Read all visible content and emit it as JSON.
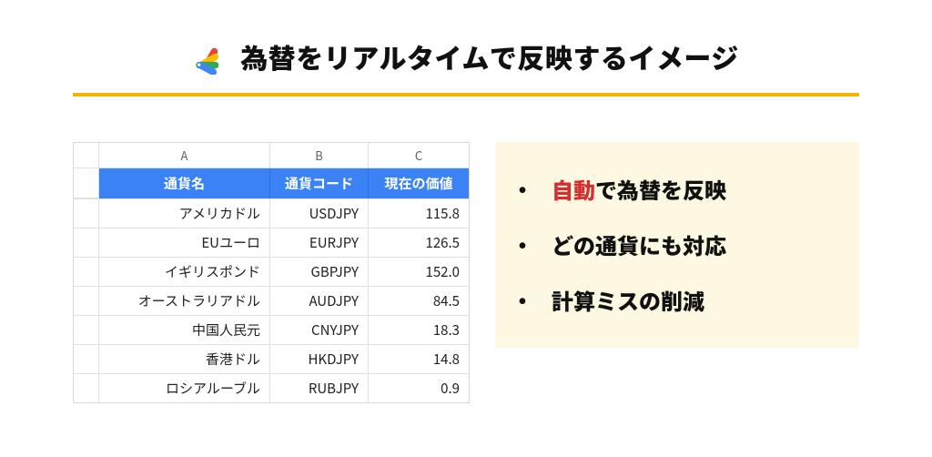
{
  "title": "為替をリアルタイムで反映するイメージ",
  "chart_data": {
    "type": "table",
    "col_letters": [
      "A",
      "B",
      "C"
    ],
    "headers": [
      "通貨名",
      "通貨コード",
      "現在の価値"
    ],
    "rows": [
      {
        "name": "アメリカドル",
        "code": "USDJPY",
        "value": "115.8"
      },
      {
        "name": "EUユーロ",
        "code": "EURJPY",
        "value": "126.5"
      },
      {
        "name": "イギリスポンド",
        "code": "GBPJPY",
        "value": "152.0"
      },
      {
        "name": "オーストラリアドル",
        "code": "AUDJPY",
        "value": "84.5"
      },
      {
        "name": "中国人民元",
        "code": "CNYJPY",
        "value": "18.3"
      },
      {
        "name": "香港ドル",
        "code": "HKDJPY",
        "value": "14.8"
      },
      {
        "name": "ロシアルーブル",
        "code": "RUBJPY",
        "value": "0.9"
      }
    ]
  },
  "bullets": [
    {
      "emphasis": "自動",
      "rest": "で為替を反映"
    },
    {
      "emphasis": "",
      "rest": "どの通貨にも対応"
    },
    {
      "emphasis": "",
      "rest": "計算ミスの削減"
    }
  ],
  "colors": {
    "accent": "#f4b400",
    "header_bg": "#3b82f6",
    "callout_bg": "#fdf8e1",
    "emphasis": "#d32f2f"
  }
}
